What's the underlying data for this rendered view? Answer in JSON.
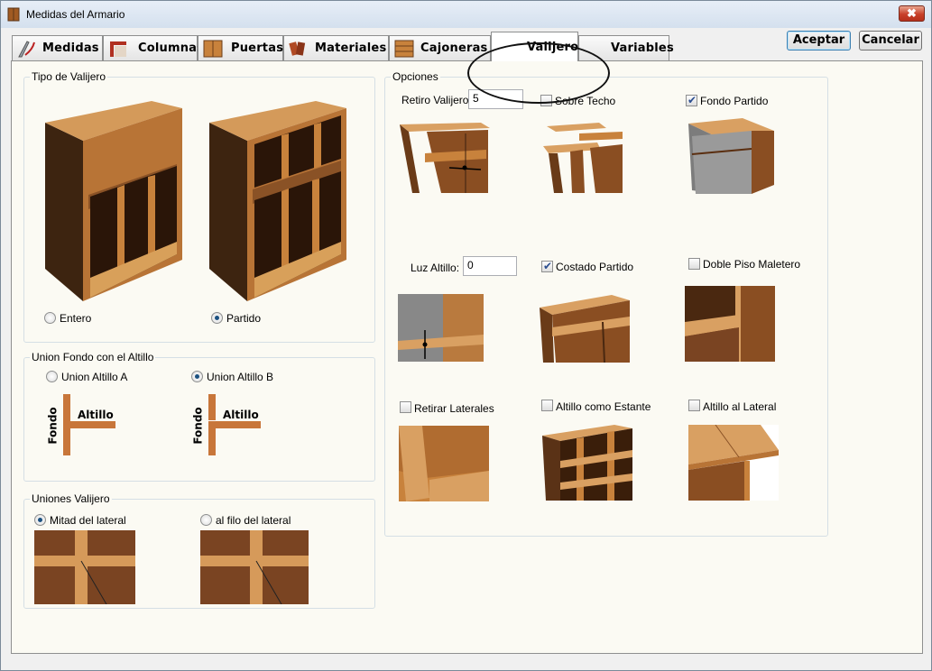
{
  "window": {
    "title": "Medidas del Armario",
    "close_label": "✖"
  },
  "tabs": [
    {
      "label": "Medidas",
      "icon": "measure-icon"
    },
    {
      "label": "Columnas",
      "icon": "columns-icon"
    },
    {
      "label": "Puertas",
      "icon": "doors-icon"
    },
    {
      "label": "Materiales",
      "icon": "materials-icon"
    },
    {
      "label": "Cajoneras",
      "icon": "drawers-icon"
    },
    {
      "label": "Valijero",
      "icon": "",
      "active": true
    },
    {
      "label": "Variables",
      "icon": ""
    }
  ],
  "buttons": {
    "accept": "Aceptar",
    "cancel": "Cancelar"
  },
  "tipo_valijero": {
    "title": "Tipo de Valijero",
    "options": [
      {
        "label": "Entero",
        "selected": false
      },
      {
        "label": "Partido",
        "selected": true
      }
    ]
  },
  "union_fondo": {
    "title": "Union Fondo con el Altillo",
    "options": [
      {
        "label": "Union Altillo A",
        "selected": false
      },
      {
        "label": "Union Altillo B",
        "selected": true
      }
    ],
    "diagram_fondo": "Fondo",
    "diagram_altillo": "Altillo"
  },
  "uniones_valijero": {
    "title": "Uniones Valijero",
    "options": [
      {
        "label": "Mitad del lateral",
        "selected": true
      },
      {
        "label": "al filo del lateral",
        "selected": false
      }
    ]
  },
  "opciones": {
    "title": "Opciones",
    "retiro_label": "Retiro Valijero :",
    "retiro_value": "5",
    "luz_label": "Luz Altillo:",
    "luz_value": "0",
    "checks": {
      "sobre_techo": {
        "label": "Sobre Techo",
        "checked": false
      },
      "fondo_partido": {
        "label": "Fondo Partido",
        "checked": true
      },
      "costado_partido": {
        "label": "Costado Partido",
        "checked": true
      },
      "doble_piso": {
        "label": "Doble Piso Maletero",
        "checked": false
      },
      "retirar_laterales": {
        "label": "Retirar Laterales",
        "checked": false
      },
      "altillo_estante": {
        "label": "Altillo como Estante",
        "checked": false
      },
      "altillo_lateral": {
        "label": "Altillo al Lateral",
        "checked": false
      }
    }
  },
  "colors": {
    "wood_light": "#c8823c",
    "wood_dark": "#5b3518",
    "panel_bg": "#fbfaf3",
    "accent": "#1c5180"
  }
}
